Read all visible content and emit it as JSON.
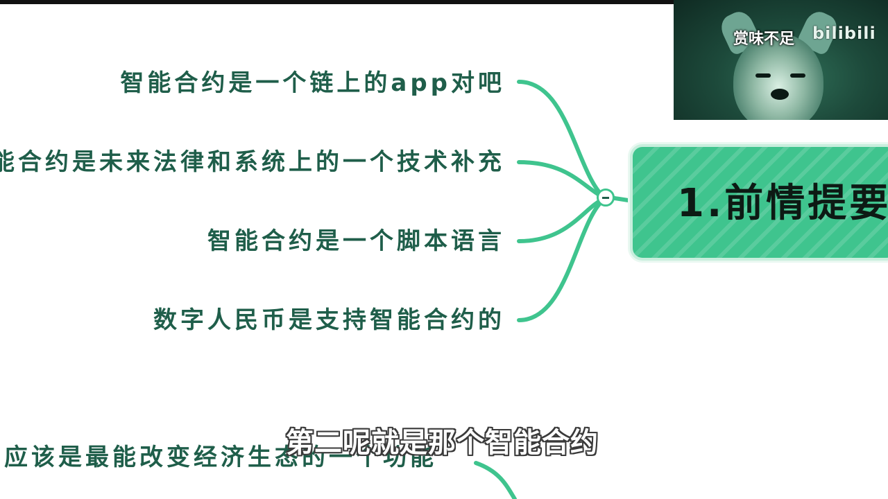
{
  "mindmap": {
    "root": {
      "label": "1.前情提要"
    },
    "branches": [
      {
        "label": "智能合约是一个链上的app对吧"
      },
      {
        "label": "智能合约是未来法律和系统上的一个技术补充"
      },
      {
        "label": "智能合约是一个脚本语言"
      },
      {
        "label": "数字人民币是支持智能合约的"
      }
    ],
    "next_branch": {
      "label": "应该是最能改变经济生态的一个功能"
    }
  },
  "video": {
    "subtitle": "第二呢就是那个智能合约",
    "pip_caption": "赏味不足",
    "pip_logo": "bilibili"
  },
  "colors": {
    "accent": "#3fc48e",
    "text": "#1f5e4a",
    "root_text": "#0d1a14"
  }
}
